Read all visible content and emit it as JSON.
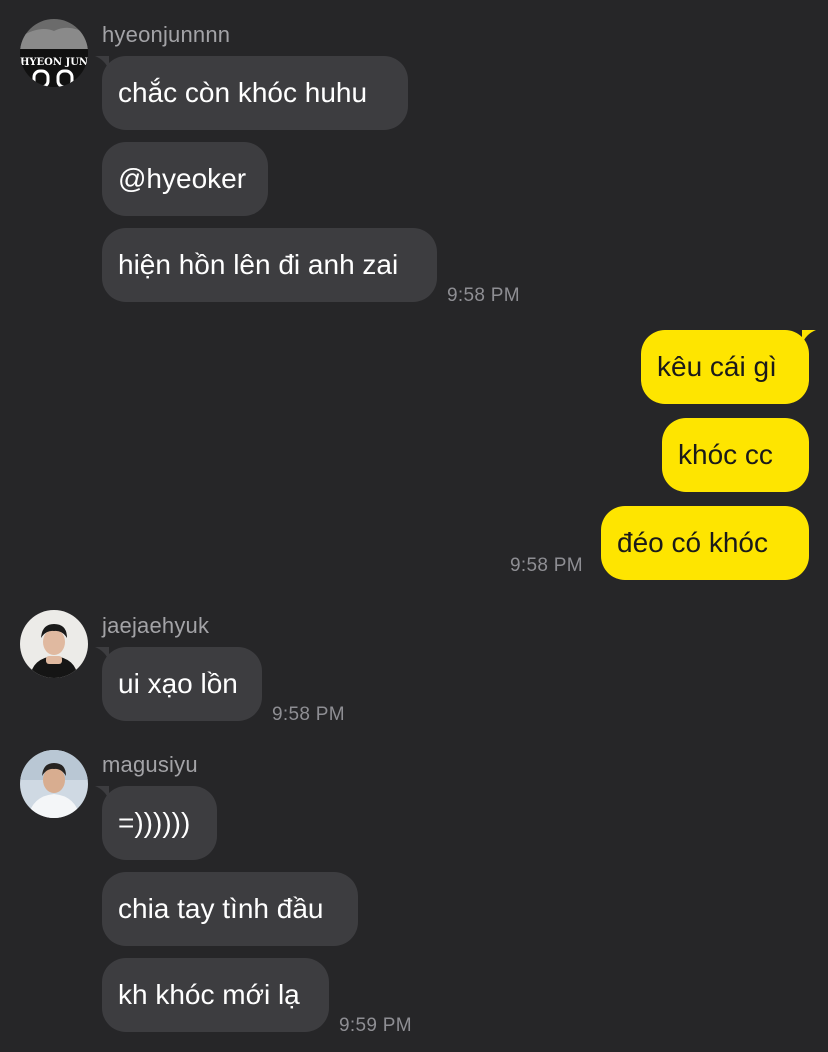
{
  "messages": [
    {
      "sender": "hyeonjunnnn",
      "avatar_text": "HYEON JUN",
      "lines": [
        "chắc còn khóc huhu",
        "@hyeoker",
        "hiện hồn lên đi anh zai"
      ],
      "time": "9:58 PM"
    },
    {
      "sender": "me",
      "lines": [
        "kêu cái gì",
        "khóc cc",
        "đéo có khóc"
      ],
      "time": "9:58 PM"
    },
    {
      "sender": "jaejaehyuk",
      "lines": [
        "ui xạo lồn"
      ],
      "time": "9:58 PM"
    },
    {
      "sender": "magusiyu",
      "lines": [
        "=))))))",
        "chia tay tình đầu",
        "kh khóc mới lạ"
      ],
      "time": "9:59 PM"
    }
  ],
  "colors": {
    "background": "#262628",
    "incoming_bubble": "#3d3d40",
    "outgoing_bubble": "#fee500",
    "timestamp": "#8e8e93"
  }
}
